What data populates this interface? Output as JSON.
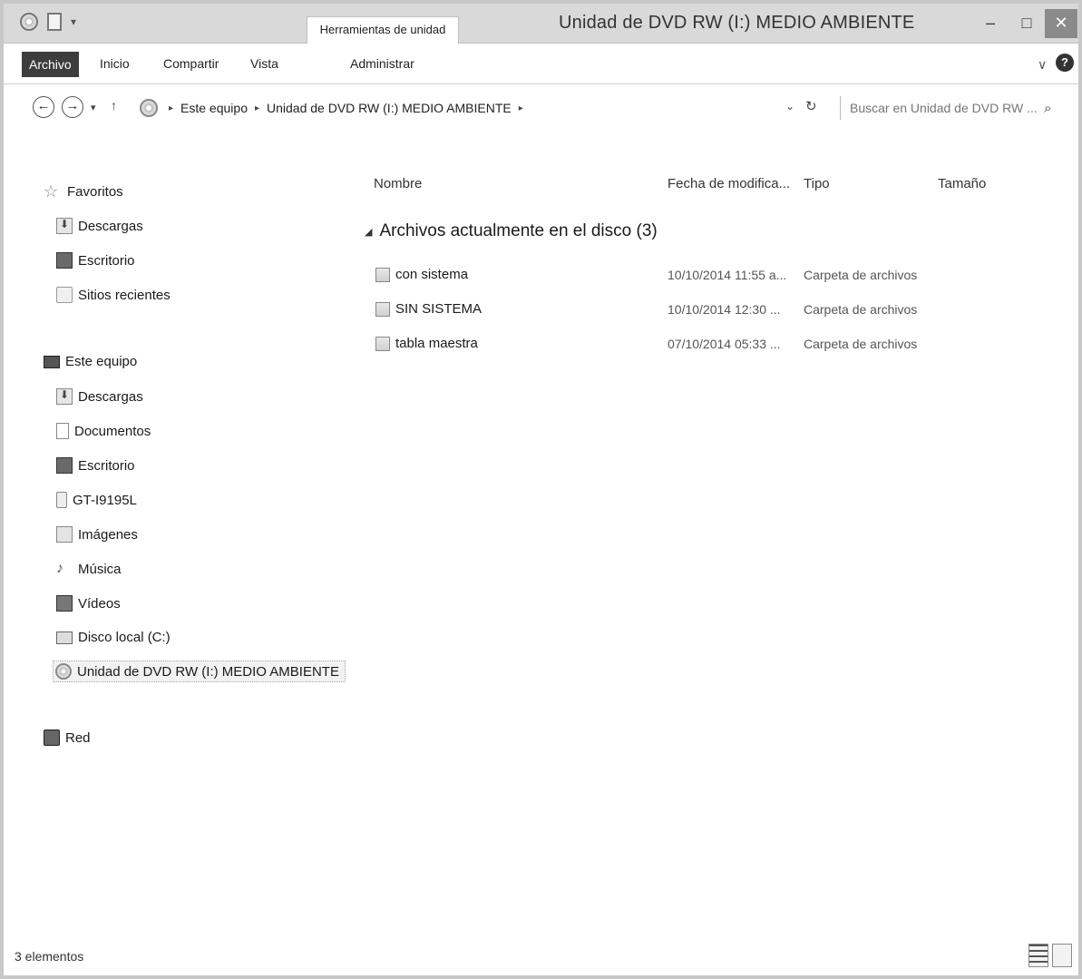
{
  "window": {
    "title": "Unidad de DVD RW (I:) MEDIO AMBIENTE",
    "contextual_tab": "Herramientas de unidad"
  },
  "ribbon": {
    "tabs": [
      "Archivo",
      "Inicio",
      "Compartir",
      "Vista",
      "Administrar"
    ]
  },
  "address": {
    "crumbs": [
      "Este equipo",
      "Unidad de DVD RW (I:) MEDIO AMBIENTE"
    ],
    "search_placeholder": "Buscar en Unidad de DVD RW ..."
  },
  "nav": {
    "favorites_label": "Favoritos",
    "favorites": [
      {
        "label": "Descargas",
        "icon": "downloads-icon"
      },
      {
        "label": "Escritorio",
        "icon": "desktop-icon"
      },
      {
        "label": "Sitios recientes",
        "icon": "recent-places-icon"
      }
    ],
    "this_pc_label": "Este equipo",
    "this_pc": [
      {
        "label": "Descargas",
        "icon": "downloads-icon"
      },
      {
        "label": "Documentos",
        "icon": "documents-icon"
      },
      {
        "label": "Escritorio",
        "icon": "desktop-icon"
      },
      {
        "label": "GT-I9195L",
        "icon": "phone-icon"
      },
      {
        "label": "Imágenes",
        "icon": "pictures-icon"
      },
      {
        "label": "Música",
        "icon": "music-icon"
      },
      {
        "label": "Vídeos",
        "icon": "videos-icon"
      },
      {
        "label": "Disco local (C:)",
        "icon": "local-disk-icon"
      },
      {
        "label": "Unidad de DVD RW (I:) MEDIO AMBIENTE",
        "icon": "dvd-drive-icon"
      }
    ],
    "network_label": "Red"
  },
  "content": {
    "columns": {
      "name": "Nombre",
      "date": "Fecha de modifica...",
      "type": "Tipo",
      "size": "Tamaño"
    },
    "group_title": "Archivos actualmente en el disco (3)",
    "rows": [
      {
        "name": "con sistema",
        "date": "10/10/2014 11:55 a...",
        "type": "Carpeta de archivos"
      },
      {
        "name": "SIN SISTEMA",
        "date": "10/10/2014 12:30 ...",
        "type": "Carpeta de archivos"
      },
      {
        "name": "tabla maestra",
        "date": "07/10/2014 05:33 ...",
        "type": "Carpeta de archivos"
      }
    ]
  },
  "status": {
    "count": "3 elementos"
  }
}
